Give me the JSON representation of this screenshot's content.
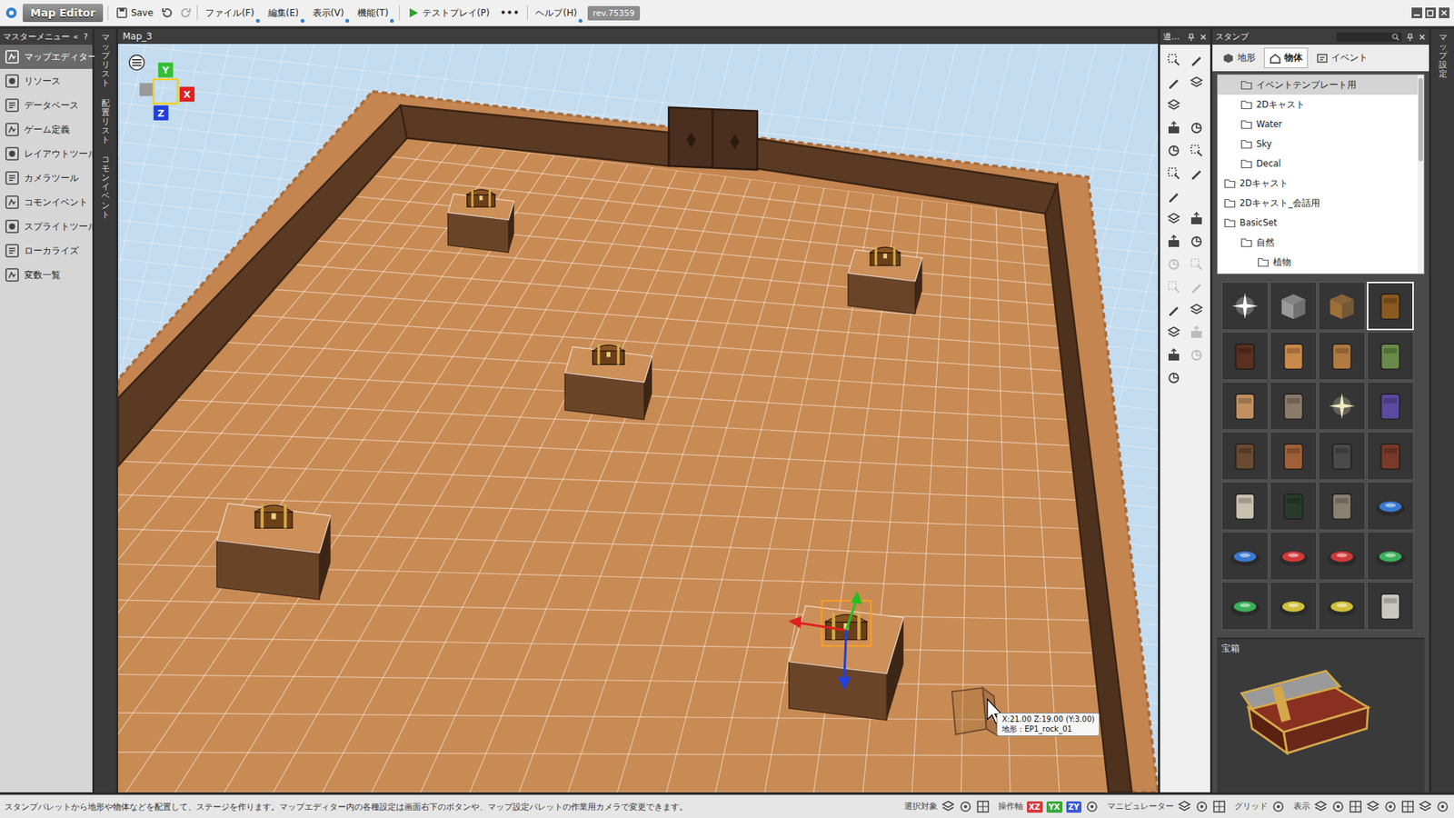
{
  "window": {
    "title": "Map Editor",
    "revision": "rev.75359"
  },
  "toolbar": {
    "save": "Save",
    "menus": [
      "ファイル(F)",
      "編集(E)",
      "表示(V)",
      "機能(T)"
    ],
    "testplay": "テストプレイ(P)",
    "more": "•••",
    "help": "ヘルプ(H)"
  },
  "master_menu": {
    "title": "マスターメニュー",
    "collapse": "«",
    "help": "?",
    "items": [
      {
        "label": "マップエディター",
        "selected": true
      },
      {
        "label": "リソース",
        "selected": false
      },
      {
        "label": "データベース",
        "selected": false
      },
      {
        "label": "ゲーム定義",
        "selected": false
      },
      {
        "label": "レイアウトツール",
        "selected": false
      },
      {
        "label": "カメラツール",
        "selected": false
      },
      {
        "label": "コモンイベント",
        "selected": false
      },
      {
        "label": "スプライトツール",
        "selected": false
      },
      {
        "label": "ローカライズ",
        "selected": false
      },
      {
        "label": "変数一覧",
        "selected": false
      }
    ]
  },
  "side_tabs": [
    "マップリスト",
    "配置リスト",
    "コモンイベント"
  ],
  "viewport": {
    "tab": "Map_3",
    "axis_labels": [
      "Y",
      "X",
      "Z"
    ],
    "objects": [
      {
        "selected": false
      },
      {
        "selected": false
      },
      {
        "selected": false
      },
      {
        "selected": false
      },
      {
        "selected": true
      }
    ],
    "tooltip": {
      "coords": "X:21.00 Z:19.00 (Y:3.00)",
      "terrain": "地形 : EP1_rock_01"
    }
  },
  "tool_palette": {
    "title": "道...",
    "tools": [
      {
        "kind": "tool",
        "disabled": false
      },
      {
        "kind": "tool",
        "disabled": false
      },
      {
        "kind": "tool",
        "disabled": false
      },
      {
        "kind": "tool",
        "disabled": false
      },
      {
        "kind": "tool",
        "disabled": false
      },
      {
        "kind": "empty",
        "disabled": false
      },
      {
        "kind": "tool",
        "disabled": false
      },
      {
        "kind": "tool",
        "disabled": false
      },
      {
        "kind": "tool",
        "disabled": false
      },
      {
        "kind": "tool",
        "disabled": false
      },
      {
        "kind": "tool",
        "disabled": false
      },
      {
        "kind": "tool",
        "disabled": false
      },
      {
        "kind": "tool",
        "disabled": false
      },
      {
        "kind": "empty",
        "disabled": false
      },
      {
        "kind": "tool",
        "disabled": false
      },
      {
        "kind": "tool",
        "disabled": false
      },
      {
        "kind": "tool",
        "disabled": false
      },
      {
        "kind": "tool",
        "disabled": false
      },
      {
        "kind": "tool",
        "disabled": true
      },
      {
        "kind": "tool",
        "disabled": true
      },
      {
        "kind": "tool",
        "disabled": true
      },
      {
        "kind": "tool",
        "disabled": true
      },
      {
        "kind": "tool",
        "disabled": false
      },
      {
        "kind": "tool",
        "disabled": false
      },
      {
        "kind": "tool",
        "disabled": false
      },
      {
        "kind": "tool",
        "disabled": true
      },
      {
        "kind": "tool",
        "disabled": false
      },
      {
        "kind": "tool",
        "disabled": true
      },
      {
        "kind": "tool",
        "disabled": false
      },
      {
        "kind": "empty",
        "disabled": false
      }
    ]
  },
  "stamp_panel": {
    "title": "スタンプ",
    "tabs": [
      {
        "label": "地形",
        "selected": false
      },
      {
        "label": "物体",
        "selected": true
      },
      {
        "label": "イベント",
        "selected": false
      }
    ],
    "tree": [
      {
        "label": "イベントテンプレート用",
        "depth": 1,
        "selected": true
      },
      {
        "label": "2Dキャスト",
        "depth": 1,
        "selected": false
      },
      {
        "label": "Water",
        "depth": 1,
        "selected": false
      },
      {
        "label": "Sky",
        "depth": 1,
        "selected": false
      },
      {
        "label": "Decal",
        "depth": 1,
        "selected": false
      },
      {
        "label": "2Dキャスト",
        "depth": 0,
        "selected": false
      },
      {
        "label": "2Dキャスト_会話用",
        "depth": 0,
        "selected": false
      },
      {
        "label": "BasicSet",
        "depth": 0,
        "selected": false
      },
      {
        "label": "自然",
        "depth": 1,
        "selected": false
      },
      {
        "label": "植物",
        "depth": 2,
        "selected": false
      }
    ],
    "thumbnails": [
      {
        "kind": "sparkle",
        "color": "#ffffff",
        "selected": false
      },
      {
        "kind": "block",
        "color": "#9a9a9a",
        "selected": false
      },
      {
        "kind": "block",
        "color": "#a0703a",
        "selected": false
      },
      {
        "kind": "object",
        "color": "#8a5a20",
        "selected": true
      },
      {
        "kind": "object",
        "color": "#5a3020",
        "selected": false
      },
      {
        "kind": "object",
        "color": "#c8894a",
        "selected": false
      },
      {
        "kind": "object",
        "color": "#b07a40",
        "selected": false
      },
      {
        "kind": "object",
        "color": "#6a8a4a",
        "selected": false
      },
      {
        "kind": "object",
        "color": "#c09060",
        "selected": false
      },
      {
        "kind": "object",
        "color": "#8a7a6a",
        "selected": false
      },
      {
        "kind": "sparkle",
        "color": "#f0e8c0",
        "selected": false
      },
      {
        "kind": "object",
        "color": "#5a4aa0",
        "selected": false
      },
      {
        "kind": "object",
        "color": "#6a4a30",
        "selected": false
      },
      {
        "kind": "object",
        "color": "#a0603a",
        "selected": false
      },
      {
        "kind": "object",
        "color": "#4a4a4a",
        "selected": false
      },
      {
        "kind": "object",
        "color": "#7a3a2a",
        "selected": false
      },
      {
        "kind": "object",
        "color": "#c8c0b0",
        "selected": false
      },
      {
        "kind": "object",
        "color": "#2a3a2a",
        "selected": false
      },
      {
        "kind": "object",
        "color": "#8a8070",
        "selected": false
      },
      {
        "kind": "pad",
        "color": "#3a7ad0",
        "selected": false
      },
      {
        "kind": "pad",
        "color": "#3a7ad0",
        "selected": false
      },
      {
        "kind": "pad",
        "color": "#d03a3a",
        "selected": false
      },
      {
        "kind": "pad",
        "color": "#d03a3a",
        "selected": false
      },
      {
        "kind": "pad",
        "color": "#3ab05a",
        "selected": false
      },
      {
        "kind": "pad",
        "color": "#3ab05a",
        "selected": false
      },
      {
        "kind": "pad",
        "color": "#d0c03a",
        "selected": false
      },
      {
        "kind": "pad",
        "color": "#d0c03a",
        "selected": false
      },
      {
        "kind": "object",
        "color": "#c8c8c0",
        "selected": false
      }
    ],
    "preview": {
      "label": "宝箱"
    }
  },
  "right_tab": "マップ設定",
  "status_bar": {
    "message": "スタンプパレットから地形や物体などを配置して、ステージを作ります。マップエディター内の各種設定は画面右下のボタンや、マップ設定パレットの作業用カメラで変更できます。",
    "controls": [
      {
        "kind": "label",
        "text": "選択対象"
      },
      {
        "kind": "icon"
      },
      {
        "kind": "icon"
      },
      {
        "kind": "icon"
      },
      {
        "kind": "label",
        "text": "操作軸"
      },
      {
        "kind": "axis",
        "text": "XZ",
        "color": "#d83a3a"
      },
      {
        "kind": "axis",
        "text": "YX",
        "color": "#3aa83a"
      },
      {
        "kind": "axis",
        "text": "ZY",
        "color": "#3a5ad8"
      },
      {
        "kind": "icon"
      },
      {
        "kind": "label",
        "text": "マニピュレーター"
      },
      {
        "kind": "icon"
      },
      {
        "kind": "icon"
      },
      {
        "kind": "icon"
      },
      {
        "kind": "label",
        "text": "グリッド"
      },
      {
        "kind": "icon"
      },
      {
        "kind": "label",
        "text": "表示"
      },
      {
        "kind": "icon"
      },
      {
        "kind": "icon"
      },
      {
        "kind": "icon"
      },
      {
        "kind": "icon"
      },
      {
        "kind": "icon"
      },
      {
        "kind": "icon"
      },
      {
        "kind": "icon"
      },
      {
        "kind": "icon"
      }
    ]
  }
}
